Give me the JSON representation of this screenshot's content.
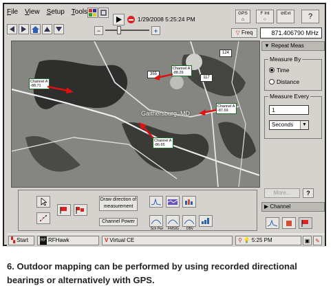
{
  "menu": [
    "File",
    "View",
    "Setup",
    "Tools"
  ],
  "toolbar": {
    "timestamp": "1/29/2008 5:25:24 PM"
  },
  "status": {
    "gps": "GPS",
    "f_int": "F Int",
    "ext": "Ext",
    "help": "?"
  },
  "freq": {
    "label": "Freq",
    "value": "871.406790 MHz"
  },
  "zoom": {
    "minus": "−",
    "plus": "+"
  },
  "sidebar": {
    "header": "Repeat Meas",
    "measure_by": {
      "title": "Measure By",
      "options": [
        "Time",
        "Distance"
      ],
      "selected": "Time"
    },
    "measure_every": {
      "title": "Measure Every",
      "value": "1",
      "unit": "Seconds"
    },
    "more": "More...",
    "help": "?",
    "channel": "Channel"
  },
  "map": {
    "city": "Gaithersburg, MD",
    "route_badges": [
      "124",
      "355",
      "117"
    ],
    "markers": [
      {
        "name": "Channel A",
        "value": "-88.71"
      },
      {
        "name": "Channel A",
        "value": "-88.29"
      },
      {
        "name": "Channel A",
        "value": "-87.69"
      },
      {
        "name": "Channel A",
        "value": "-86.65"
      }
    ]
  },
  "bottom_panel": {
    "draw_direction": "Draw direction of measurement",
    "channel_power": "Channel Power",
    "mini_labels": [
      "Sch Pwr",
      "FMSIG",
      "DBV"
    ]
  },
  "taskbar": {
    "start": "Start",
    "app": "RFHawk",
    "virtual": "Virtual CE",
    "clock": "5:25 PM"
  },
  "caption": "6.  Outdoor mapping can be performed by using recorded directional bearings or alternatively with GPS."
}
